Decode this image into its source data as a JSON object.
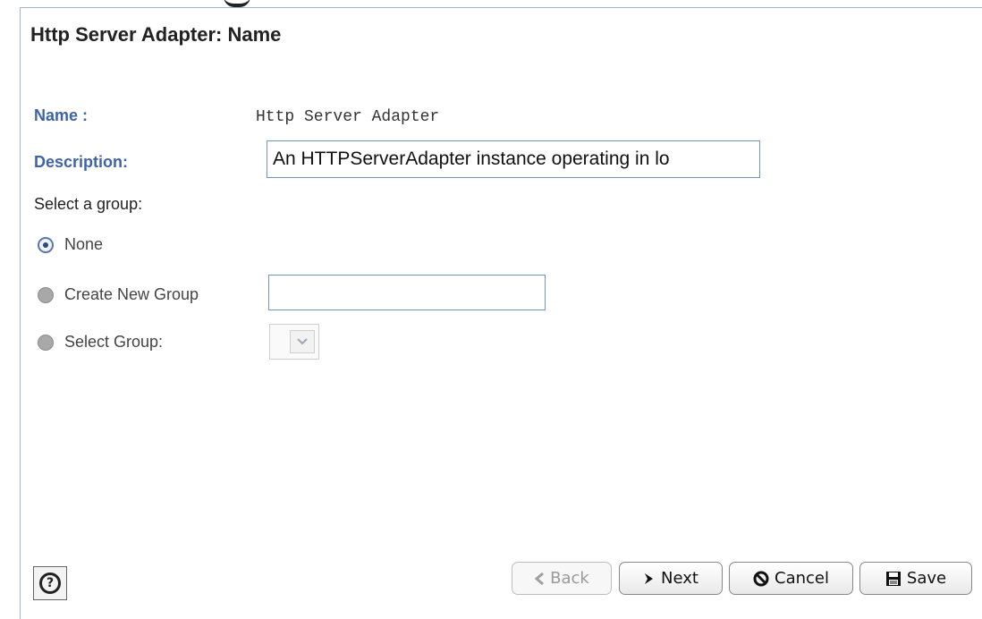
{
  "header": {
    "title": "Http Server Adapter: Name"
  },
  "form": {
    "name_label": "Name :",
    "name_value": "Http Server Adapter",
    "description_label": "Description:",
    "description_value": "An HTTPServerAdapter instance operating in lo",
    "group_section_label": "Select a group:",
    "group_options": [
      {
        "label": "None",
        "checked": true
      },
      {
        "label": "Create New Group",
        "checked": false
      },
      {
        "label": "Select Group:",
        "checked": false
      }
    ],
    "new_group_value": "",
    "select_group_value": ""
  },
  "footer": {
    "help_icon": "question-circle-icon",
    "back_label": "Back",
    "next_label": "Next",
    "cancel_label": "Cancel",
    "save_label": "Save"
  }
}
